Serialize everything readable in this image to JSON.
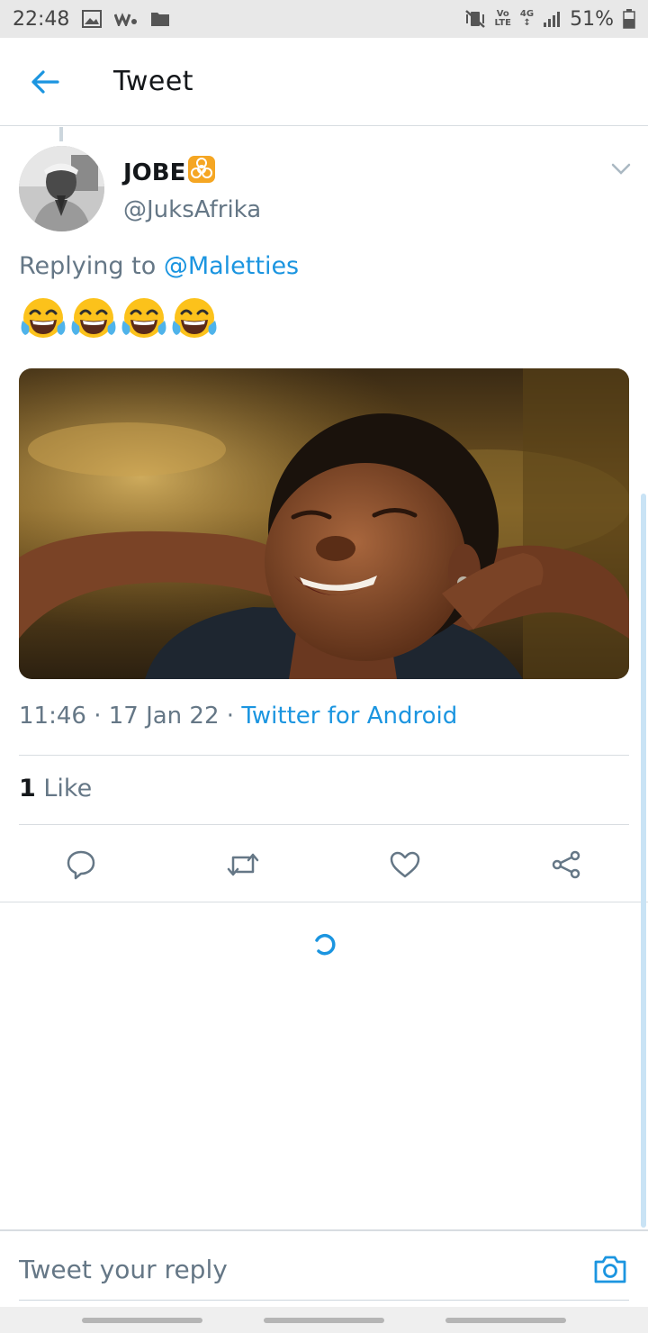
{
  "status_bar": {
    "time": "22:48",
    "volte_top": "Vo",
    "volte_bottom": "LTE",
    "network": "4G",
    "battery": "51%"
  },
  "header": {
    "title": "Tweet"
  },
  "tweet": {
    "author_name": "JOBE",
    "author_handle": "@JuksAfrika",
    "replying_prefix": "Replying to ",
    "replying_to": "@Maletties",
    "emoji_count": 4,
    "time": "11:46",
    "separator": " · ",
    "date": "17 Jan 22",
    "source": "Twitter for Android",
    "like_count": "1",
    "like_label": " Like"
  },
  "composer": {
    "placeholder": "Tweet your reply"
  },
  "colors": {
    "accent": "#1b95e0",
    "secondary_text": "#657786",
    "primary_text": "#14171a",
    "divider": "#d8dde1"
  },
  "icons": {
    "back": "arrow-left-icon",
    "caret": "chevron-down-icon",
    "reply": "comment-bubble-icon",
    "retweet": "retweet-icon",
    "like": "heart-icon",
    "share": "share-icon",
    "camera": "camera-icon",
    "loading": "spinner-icon"
  }
}
